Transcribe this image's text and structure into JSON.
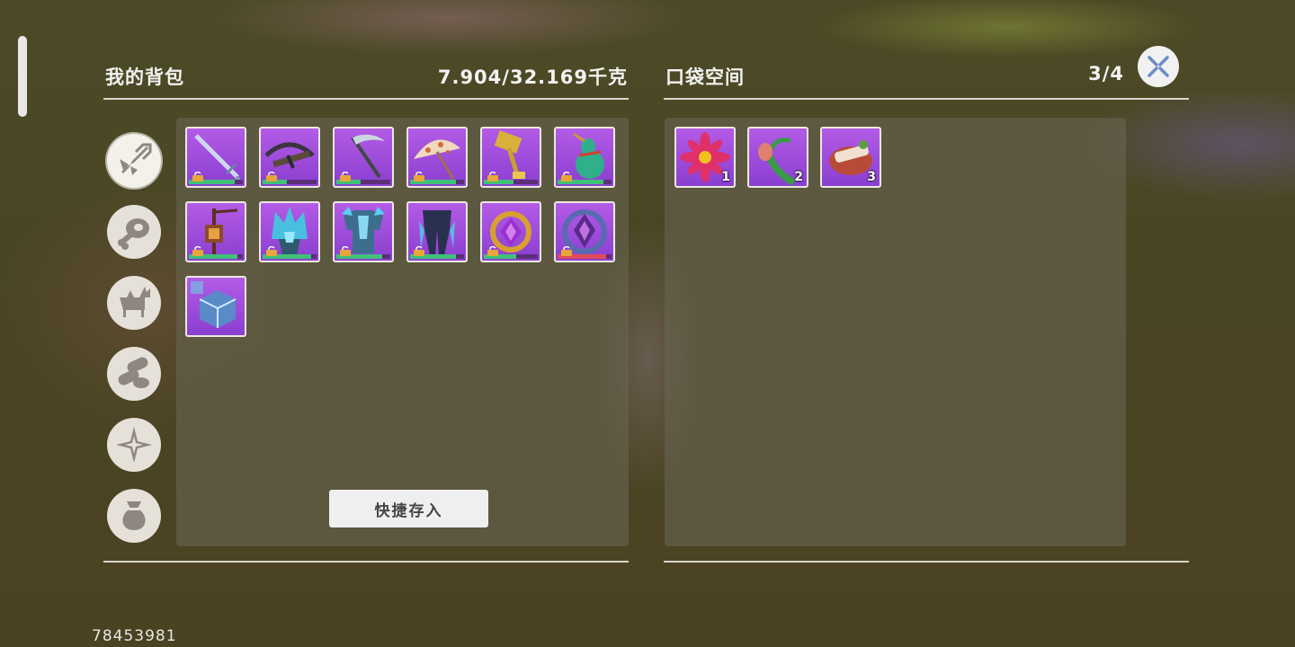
{
  "backpack": {
    "title": "我的背包",
    "weight": "7.904/32.169千克",
    "quick_store_label": "快捷存入"
  },
  "pocket": {
    "title": "口袋空间",
    "capacity": "3/4"
  },
  "categories": [
    {
      "icon": "weapon-icon",
      "active": true
    },
    {
      "icon": "food-meat-icon",
      "active": false
    },
    {
      "icon": "mount-icon",
      "active": false
    },
    {
      "icon": "medicine-pill-icon",
      "active": false
    },
    {
      "icon": "sparkle-icon",
      "active": false
    },
    {
      "icon": "pouch-bag-icon",
      "active": false
    }
  ],
  "backpack_items": [
    {
      "icon": "long-sword-icon",
      "durability": 0.85,
      "locked": true
    },
    {
      "icon": "crossbow-icon",
      "durability": 0.45,
      "locked": true
    },
    {
      "icon": "scythe-icon",
      "durability": 0.45,
      "locked": true
    },
    {
      "icon": "paper-umbrella-icon",
      "durability": 0.85,
      "locked": true
    },
    {
      "icon": "golden-hammer-icon",
      "durability": 0.55,
      "locked": true
    },
    {
      "icon": "jade-gourd-icon",
      "durability": 0.85,
      "locked": true
    },
    {
      "icon": "lantern-staff-icon",
      "durability": 0.9,
      "locked": true
    },
    {
      "icon": "crystal-helmet-icon",
      "durability": 0.9,
      "locked": true
    },
    {
      "icon": "crystal-armor-icon",
      "durability": 0.85,
      "locked": true
    },
    {
      "icon": "crystal-leggings-icon",
      "durability": 0.85,
      "locked": true
    },
    {
      "icon": "gold-amulet-icon",
      "durability": 0.6,
      "locked": true
    },
    {
      "icon": "gem-amulet-icon",
      "durability": 0.9,
      "locked": true
    },
    {
      "icon": "magic-cube-icon",
      "durability": null,
      "locked": false
    }
  ],
  "pocket_items": [
    {
      "icon": "lotus-flower-icon",
      "count": "1"
    },
    {
      "icon": "sprout-bud-icon",
      "count": "2"
    },
    {
      "icon": "meat-dish-icon",
      "count": "3"
    }
  ],
  "player_id": "78453981",
  "colors": {
    "slot_purple": "#9b4ddb",
    "durability_green": "#3fc17a",
    "durability_red": "#e04b5a"
  }
}
